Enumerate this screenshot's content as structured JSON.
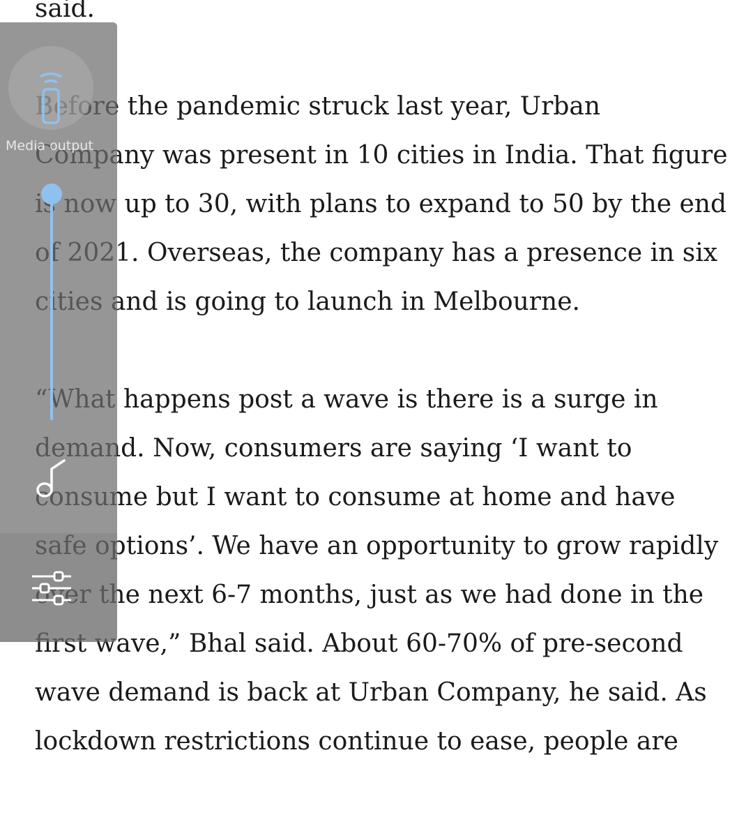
{
  "article": {
    "line0": "said.",
    "para1": [
      "Before the pandemic struck last year, Urban",
      "Company was present in 10 cities in India. That figure",
      "is now up to 30, with plans to expand to 50 by the end",
      "of 2021. Overseas, the company has a presence in six",
      "cities and is going to launch in Melbourne."
    ],
    "para2": [
      "“What happens post a wave is there is a surge in",
      "demand. Now, consumers are saying ‘I want to",
      "consume but I want to consume at home and have",
      "safe options’. We have an opportunity to grow rapidly",
      "over the next 6-7 months, just as we had done in the",
      "first wave,” Bhal said. About 60-70% of pre-second",
      "wave demand is back at Urban Company, he said. As",
      "lockdown restrictions continue to ease, people are"
    ]
  },
  "volume_panel": {
    "media_output_label": "Media output",
    "media_output_icon": "media-output-icon",
    "media_volume_level": 0.92,
    "music_icon": "music-note-icon",
    "settings_icon": "sliders-settings-icon",
    "accent_color": "#8fc1ef"
  }
}
